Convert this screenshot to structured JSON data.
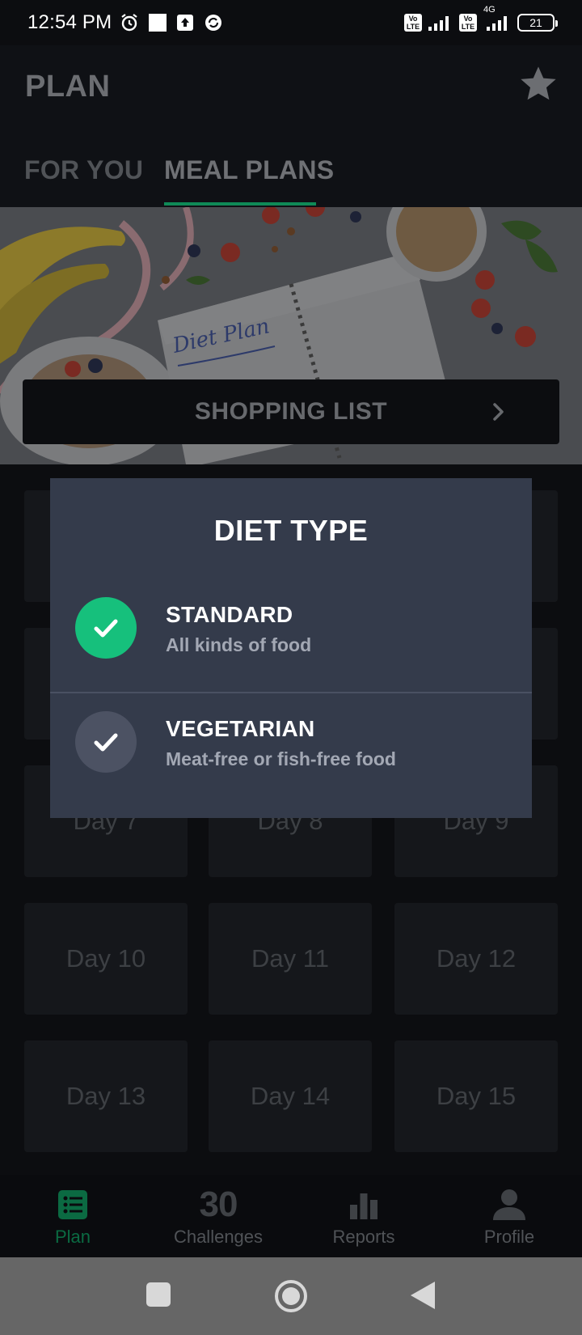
{
  "status_bar": {
    "time": "12:54 PM",
    "icons_left": [
      "alarm-icon",
      "square-notification-icon",
      "upload-icon",
      "sync-icon"
    ],
    "volte_label": "Vo LTE",
    "network_label": "4G",
    "battery": "21"
  },
  "header": {
    "title": "PLAN",
    "favorite_icon": "star-icon"
  },
  "tabs": [
    {
      "label": "FOR YOU",
      "active": false
    },
    {
      "label": "MEAL PLANS",
      "active": true
    }
  ],
  "hero": {
    "image": "diet-plan-photo",
    "shopping_list_label": "SHOPPING LIST"
  },
  "days": {
    "row1": [
      "",
      "",
      ""
    ],
    "row2": [
      "",
      "",
      ""
    ],
    "row3": [
      "Day 7",
      "Day 8",
      "Day 9"
    ],
    "row4": [
      "Day 10",
      "Day 11",
      "Day 12"
    ],
    "row5": [
      "Day 13",
      "Day 14",
      "Day 15"
    ]
  },
  "dialog": {
    "title": "DIET TYPE",
    "options": [
      {
        "title": "STANDARD",
        "subtitle": "All kinds of food",
        "selected": true
      },
      {
        "title": "VEGETARIAN",
        "subtitle": "Meat-free or fish-free food",
        "selected": false
      }
    ]
  },
  "bottom_nav": {
    "items": [
      {
        "label": "Plan",
        "icon": "plan-list-icon",
        "active": true
      },
      {
        "label": "Challenges",
        "icon_text": "30",
        "active": false
      },
      {
        "label": "Reports",
        "icon": "bar-chart-icon",
        "active": false
      },
      {
        "label": "Profile",
        "icon": "person-icon",
        "active": false
      }
    ]
  },
  "system_nav": [
    "recent-apps-icon",
    "home-icon",
    "back-icon"
  ],
  "colors": {
    "accent": "#16c07c",
    "dialog_bg": "#343b4b",
    "background": "#0c0d10"
  }
}
